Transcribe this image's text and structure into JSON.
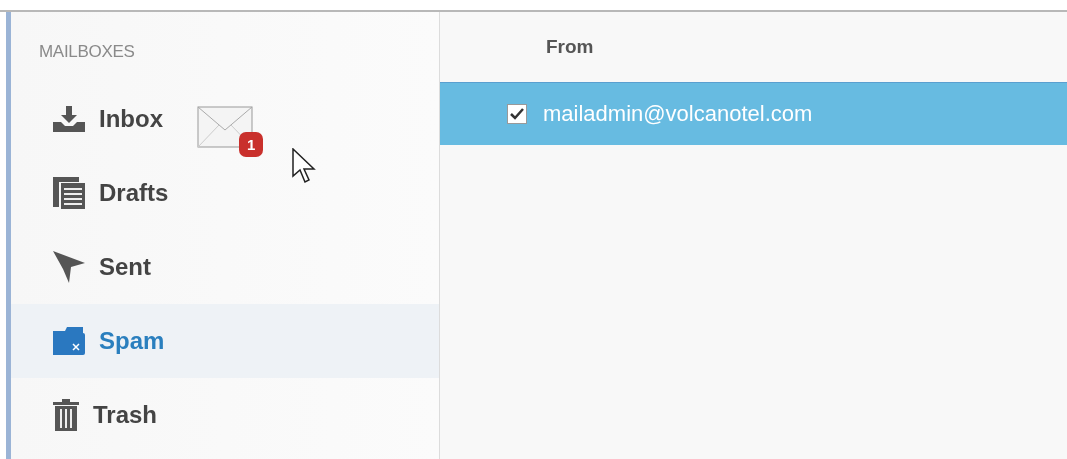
{
  "sidebar": {
    "heading": "MAILBOXES",
    "items": [
      {
        "kind": "inbox",
        "label": "Inbox",
        "selected": false
      },
      {
        "kind": "drafts",
        "label": "Drafts",
        "selected": false
      },
      {
        "kind": "sent",
        "label": "Sent",
        "selected": false
      },
      {
        "kind": "spam",
        "label": "Spam",
        "selected": true
      },
      {
        "kind": "trash",
        "label": "Trash",
        "selected": false
      }
    ]
  },
  "drag": {
    "badge": "1"
  },
  "messages": {
    "columns": [
      "From"
    ],
    "rows": [
      {
        "from": "mailadmin@volcanotel.com",
        "checked": true,
        "selected": true
      }
    ]
  }
}
